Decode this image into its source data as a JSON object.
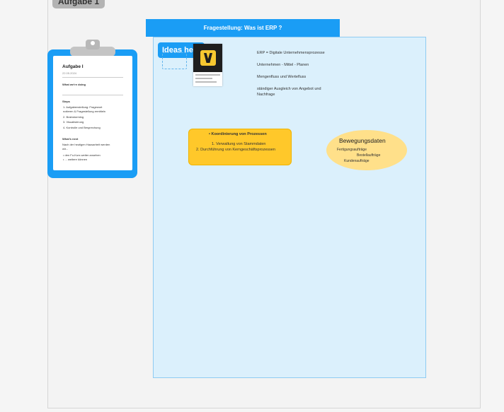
{
  "frame": {
    "tag": "Aufgabe 1"
  },
  "section": {
    "title": "Fragestellung:  Was ist ERP ?",
    "ideas_label": "Ideas here"
  },
  "notes": {
    "items": [
      "ERP = Digitale Unternehmensprozesse",
      "Unternehmen - Mittel - Planen",
      "Mengenfluss und Wertefluss",
      "ständiger Ausgleich von Angebot und",
      "Nachfrage"
    ]
  },
  "process_box": {
    "heading": "Koordinierung von Prozessen",
    "items": [
      "1. Verwaltung von Stammdaten",
      "2. Durchführung von Kerngeschäftsprozessen"
    ]
  },
  "movement": {
    "title": "Bewegungsdaten",
    "items": [
      "Fertigungsaufträge",
      "Bestellaufträge",
      "Kundenaufträge"
    ]
  },
  "clipboard": {
    "title": "Aufgabe I",
    "date": "22.05.2024",
    "what_label": "What we're doing",
    "steps_label": "Steps",
    "steps": [
      "1. Aufgabenstellung: Fragewort",
      "    notieren & Fragestellung ermitteln",
      "2. Brainstorming",
      "3. Visualisierung",
      "4. Kontrolle und Besprechung"
    ],
    "next_label": "What's next",
    "next_text": [
      "Nach der heutigen Hausarbeit werden",
      "wir..."
    ],
    "next_items": [
      "• den Fu-Kurs weiter ansehen",
      "• ... weitere können"
    ]
  },
  "colors": {
    "accent_blue": "#1a9df5",
    "section_fill": "#dbf0fc",
    "sticky_yellow": "#ffc82a",
    "oval_yellow": "#ffe08a"
  }
}
